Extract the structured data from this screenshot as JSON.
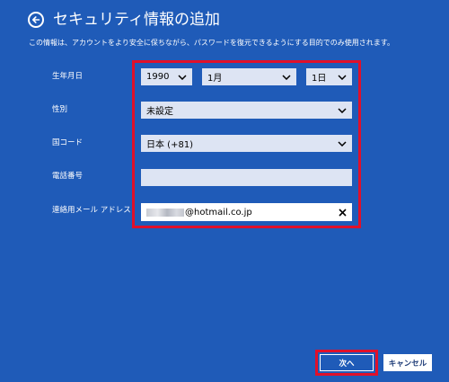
{
  "header": {
    "title": "セキュリティ情報の追加"
  },
  "description": "この情報は、アカウントをより安全に保ちながら、パスワードを復元できるようにする目的でのみ使用されます。",
  "form": {
    "birthdate": {
      "label": "生年月日",
      "year": "1990",
      "month": "1月",
      "day": "1日"
    },
    "gender": {
      "label": "性別",
      "value": "未設定"
    },
    "country_code": {
      "label": "国コード",
      "value": "日本 (+81)"
    },
    "phone": {
      "label": "電話番号",
      "value": ""
    },
    "email": {
      "label": "連絡用メール アドレス",
      "value": "@hotmail.co.jp"
    }
  },
  "buttons": {
    "next": "次へ",
    "cancel": "キャンセル"
  },
  "colors": {
    "background": "#1f5bb8",
    "field": "#dde4f3",
    "highlight": "#e0102a"
  },
  "icons": {
    "back": "back-arrow-icon",
    "dropdown": "chevron-down-icon",
    "clear": "close-icon"
  }
}
